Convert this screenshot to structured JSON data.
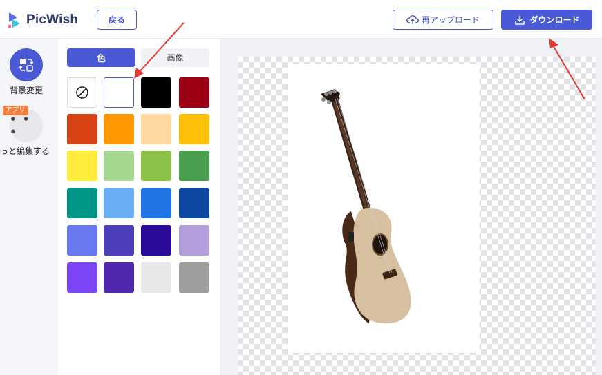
{
  "header": {
    "logo_text": "PicWish",
    "back_label": "戻る",
    "reupload_label": "再アップロード",
    "download_label": "ダウンロード"
  },
  "rail": {
    "background_label": "背景変更",
    "app_badge": "アプリ",
    "more_icon": "• • •",
    "more_label": "っと編集する"
  },
  "panel": {
    "tab_color": "色",
    "tab_image": "画像",
    "swatches": [
      "none",
      "#ffffff",
      "#000000",
      "#9b0014",
      "#d84315",
      "#ff9800",
      "#ffd9a0",
      "#ffc107",
      "#ffeb3b",
      "#a5d68f",
      "#8bc34a",
      "#4a9f4e",
      "#009688",
      "#6aaff4",
      "#2076e5",
      "#0d47a1",
      "#6a78f0",
      "#4b3eb8",
      "#2a0a96",
      "#b39ddb",
      "#7c45f5",
      "#5028ad",
      "#e8e8e8",
      "#9e9e9e"
    ]
  },
  "colors": {
    "accent": "#4a5ad6",
    "annotation_arrow": "#e53935"
  }
}
